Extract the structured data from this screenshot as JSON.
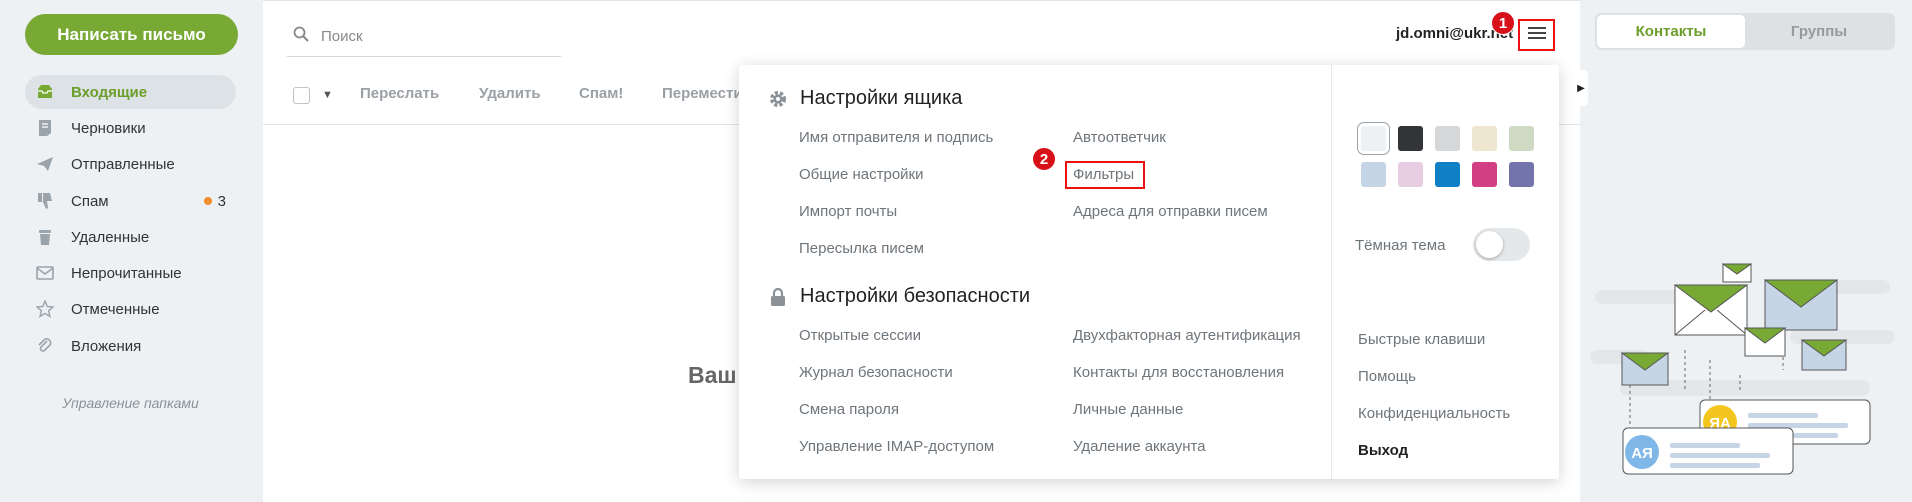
{
  "compose": {
    "label": "Написать письмо"
  },
  "folders": [
    {
      "label": "Входящие",
      "icon": "inbox-icon",
      "active": true
    },
    {
      "label": "Черновики",
      "icon": "draft-icon"
    },
    {
      "label": "Отправленные",
      "icon": "sent-icon"
    },
    {
      "label": "Спам",
      "icon": "thumb-down-icon",
      "count": "3"
    },
    {
      "label": "Удаленные",
      "icon": "trash-icon"
    },
    {
      "label": "Непрочитанные",
      "icon": "unread-envelope-icon"
    },
    {
      "label": "Отмеченные",
      "icon": "star-icon"
    },
    {
      "label": "Вложения",
      "icon": "paperclip-icon"
    }
  ],
  "manage_folders": "Управление папками",
  "search": {
    "placeholder": "Поиск"
  },
  "user": {
    "email": "jd.omni@ukr.net"
  },
  "toolbar": {
    "forward": "Переслать",
    "delete": "Удалить",
    "spam": "Спам!",
    "move": "Переместить"
  },
  "empty_state": {
    "title": "Ваш"
  },
  "annotations": {
    "badge1": "1",
    "badge2": "2"
  },
  "settings_menu": {
    "mailbox": {
      "title": "Настройки ящика",
      "col1": [
        "Имя отправителя и подпись",
        "Общие настройки",
        "Импорт почты",
        "Пересылка писем"
      ],
      "col2": [
        "Автоответчик",
        "Фильтры",
        "Адреса для отправки писем"
      ]
    },
    "security": {
      "title": "Настройки безопасности",
      "col1": [
        "Открытые сессии",
        "Журнал безопасности",
        "Смена пароля",
        "Управление IMAP-доступом"
      ],
      "col2": [
        "Двухфакторная аутентификация",
        "Контакты для восстановления",
        "Личные данные",
        "Удаление аккаунта"
      ]
    },
    "themes": [
      "#eef1f3",
      "#333438",
      "#d5d7d9",
      "#eee6cf",
      "#cfdac4",
      "#c6d5e5",
      "#e6cde2",
      "#0f7fc6",
      "#d23f83",
      "#7474ad"
    ],
    "dark_theme_label": "Тёмная тема",
    "links": [
      "Быстрые клавиши",
      "Помощь",
      "Конфиденциальность"
    ],
    "logout": "Выход"
  },
  "contacts_tabs": [
    "Контакты",
    "Группы"
  ],
  "illustration": {
    "avatar1": "ЯА",
    "avatar2": "АЯ"
  }
}
